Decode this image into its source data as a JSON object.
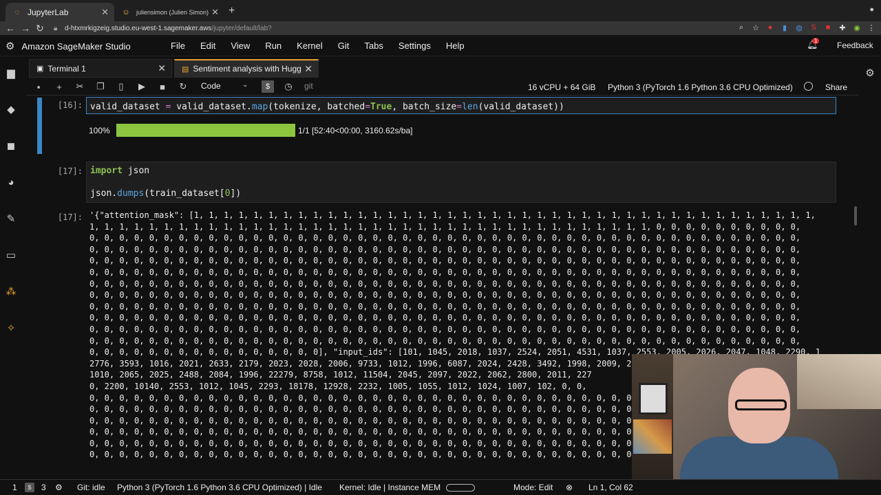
{
  "browser": {
    "tabs": [
      {
        "title": "JupyterLab",
        "icon": "loading-icon"
      },
      {
        "title": "juliensimon (Julien Simon)",
        "icon": "hugging-face-icon"
      }
    ],
    "url_host": "d-htxmrkigzeig.studio.eu-west-1.sagemaker.aws",
    "url_path": "/jupyter/default/lab?"
  },
  "app": {
    "title": "Amazon SageMaker Studio",
    "menus": [
      "File",
      "Edit",
      "View",
      "Run",
      "Kernel",
      "Git",
      "Tabs",
      "Settings",
      "Help"
    ],
    "notification_count": "1",
    "feedback_label": "Feedback"
  },
  "doc_tabs": [
    {
      "title": "Terminal 1"
    },
    {
      "title": "Sentiment analysis with Hugg"
    }
  ],
  "toolbar": {
    "cell_type": "Code",
    "git_label": "git",
    "resources": "16 vCPU + 64 GiB",
    "kernel": "Python 3 (PyTorch 1.6 Python 3.6 CPU Optimized)",
    "share_label": "Share"
  },
  "cells": {
    "c16": {
      "prompt": "[16]:",
      "progress_percent_label": "100%",
      "progress_fraction": 1.0,
      "progress_text": "1/1 [52:40<00:00, 3160.62s/ba]"
    },
    "c17": {
      "prompt": "[17]:",
      "out_prompt": "[17]:"
    }
  },
  "output_lines": [
    "'{\"attention_mask\": [1, 1, 1, 1, 1, 1, 1, 1, 1, 1, 1, 1, 1, 1, 1, 1, 1, 1, 1, 1, 1, 1, 1, 1, 1, 1, 1, 1, 1, 1, 1, 1, 1, 1, 1, 1, 1, 1, 1, 1, 1, 1,",
    "1, 1, 1, 1, 1, 1, 1, 1, 1, 1, 1, 1, 1, 1, 1, 1, 1, 1, 1, 1, 1, 1, 1, 1, 1, 1, 1, 1, 1, 1, 1, 1, 1, 1, 1, 1, 1, 1, 0, 0, 0, 0, 0, 0, 0, 0, 0, 0,",
    "0, 0, 0, 0, 0, 0, 0, 0, 0, 0, 0, 0, 0, 0, 0, 0, 0, 0, 0, 0, 0, 0, 0, 0, 0, 0, 0, 0, 0, 0, 0, 0, 0, 0, 0, 0, 0, 0, 0, 0, 0, 0, 0, 0, 0, 0, 0, 0,",
    "0, 0, 0, 0, 0, 0, 0, 0, 0, 0, 0, 0, 0, 0, 0, 0, 0, 0, 0, 0, 0, 0, 0, 0, 0, 0, 0, 0, 0, 0, 0, 0, 0, 0, 0, 0, 0, 0, 0, 0, 0, 0, 0, 0, 0, 0, 0, 0,",
    "0, 0, 0, 0, 0, 0, 0, 0, 0, 0, 0, 0, 0, 0, 0, 0, 0, 0, 0, 0, 0, 0, 0, 0, 0, 0, 0, 0, 0, 0, 0, 0, 0, 0, 0, 0, 0, 0, 0, 0, 0, 0, 0, 0, 0, 0, 0, 0,",
    "0, 0, 0, 0, 0, 0, 0, 0, 0, 0, 0, 0, 0, 0, 0, 0, 0, 0, 0, 0, 0, 0, 0, 0, 0, 0, 0, 0, 0, 0, 0, 0, 0, 0, 0, 0, 0, 0, 0, 0, 0, 0, 0, 0, 0, 0, 0, 0,",
    "0, 0, 0, 0, 0, 0, 0, 0, 0, 0, 0, 0, 0, 0, 0, 0, 0, 0, 0, 0, 0, 0, 0, 0, 0, 0, 0, 0, 0, 0, 0, 0, 0, 0, 0, 0, 0, 0, 0, 0, 0, 0, 0, 0, 0, 0, 0, 0,",
    "0, 0, 0, 0, 0, 0, 0, 0, 0, 0, 0, 0, 0, 0, 0, 0, 0, 0, 0, 0, 0, 0, 0, 0, 0, 0, 0, 0, 0, 0, 0, 0, 0, 0, 0, 0, 0, 0, 0, 0, 0, 0, 0, 0, 0, 0, 0, 0,",
    "0, 0, 0, 0, 0, 0, 0, 0, 0, 0, 0, 0, 0, 0, 0, 0, 0, 0, 0, 0, 0, 0, 0, 0, 0, 0, 0, 0, 0, 0, 0, 0, 0, 0, 0, 0, 0, 0, 0, 0, 0, 0, 0, 0, 0, 0, 0, 0,",
    "0, 0, 0, 0, 0, 0, 0, 0, 0, 0, 0, 0, 0, 0, 0, 0, 0, 0, 0, 0, 0, 0, 0, 0, 0, 0, 0, 0, 0, 0, 0, 0, 0, 0, 0, 0, 0, 0, 0, 0, 0, 0, 0, 0, 0, 0, 0, 0,",
    "0, 0, 0, 0, 0, 0, 0, 0, 0, 0, 0, 0, 0, 0, 0, 0, 0, 0, 0, 0, 0, 0, 0, 0, 0, 0, 0, 0, 0, 0, 0, 0, 0, 0, 0, 0, 0, 0, 0, 0, 0, 0, 0, 0, 0, 0, 0, 0,",
    "0, 0, 0, 0, 0, 0, 0, 0, 0, 0, 0, 0, 0, 0, 0, 0, 0, 0, 0, 0, 0, 0, 0, 0, 0, 0, 0, 0, 0, 0, 0, 0, 0, 0, 0, 0, 0, 0, 0, 0, 0, 0, 0, 0, 0, 0, 0, 0,",
    "0, 0, 0, 0, 0, 0, 0, 0, 0, 0, 0, 0, 0, 0, 0, 0], \"input_ids\": [101, 1045, 2018, 1037, 2524, 2051, 4531, 1037, 2553, 2005, 2026, 2047, 1048, 2290, 1",
    "2776, 3593, 1016, 2021, 2633, 2179, 2023, 2028, 2006, 9733, 1012, 1996, 6087, 2024, 2428, 3492, 1998, 2009, 2573, 2074, 2004, 2092, 2004,",
    "1010, 2065, 2025, 2488, 2084, 1996, 22279, 8758, 1012, 11504, 2045, 2097, 2022, 2062, 2800, 2011, 227",
    "0, 2200, 10140, 2553, 1012, 1045, 2293, 18178, 12928, 2232, 1005, 1055, 1012, 1024, 1007, 102, 0, 0,",
    "0, 0, 0, 0, 0, 0, 0, 0, 0, 0, 0, 0, 0, 0, 0, 0, 0, 0, 0, 0, 0, 0, 0, 0, 0, 0, 0, 0, 0, 0, 0, 0, 0, 0, 0, 0, 0, 0, 0, 0, 0, 0, 0, 0, 0, 0, 0, 0,",
    "0, 0, 0, 0, 0, 0, 0, 0, 0, 0, 0, 0, 0, 0, 0, 0, 0, 0, 0, 0, 0, 0, 0, 0, 0, 0, 0, 0, 0, 0, 0, 0, 0, 0, 0, 0, 0, 0, 0, 0, 0, 0, 0, 0, 0, 0, 0, 0,",
    "0, 0, 0, 0, 0, 0, 0, 0, 0, 0, 0, 0, 0, 0, 0, 0, 0, 0, 0, 0, 0, 0, 0, 0, 0, 0, 0, 0, 0, 0, 0, 0, 0, 0, 0, 0, 0, 0, 0, 0, 0, 0, 0, 0, 0, 0, 0, 0,",
    "0, 0, 0, 0, 0, 0, 0, 0, 0, 0, 0, 0, 0, 0, 0, 0, 0, 0, 0, 0, 0, 0, 0, 0, 0, 0, 0, 0, 0, 0, 0, 0, 0, 0, 0, 0, 0, 0, 0, 0, 0, 0, 0, 0, 0, 0, 0, 0,",
    "0, 0, 0, 0, 0, 0, 0, 0, 0, 0, 0, 0, 0, 0, 0, 0, 0, 0, 0, 0, 0, 0, 0, 0, 0, 0, 0, 0, 0, 0, 0, 0, 0, 0, 0, 0, 0, 0, 0, 0, 0, 0, 0, 0, 0, 0, 0, 0,",
    "0, 0, 0, 0, 0, 0, 0, 0, 0, 0, 0, 0, 0, 0, 0, 0, 0, 0, 0, 0, 0, 0, 0, 0, 0, 0, 0, 0, 0, 0, 0, 0, 0, 0, 0, 0, 0, 0, 0, 0, 0, 0, 0, 0, 0, 0, 0, 0,"
  ],
  "statusbar": {
    "count1": "1",
    "count2": "3",
    "git": "Git: idle",
    "kernel": "Python 3 (PyTorch 1.6 Python 3.6 CPU Optimized) | Idle",
    "kernel_mem": "Kernel: Idle | Instance MEM",
    "mode": "Mode: Edit",
    "position": "Ln 1, Col 62"
  },
  "colors": {
    "accent": "#e8a232",
    "selected_cell": "#3b86c6",
    "progress_fill": "#8cc63f"
  }
}
